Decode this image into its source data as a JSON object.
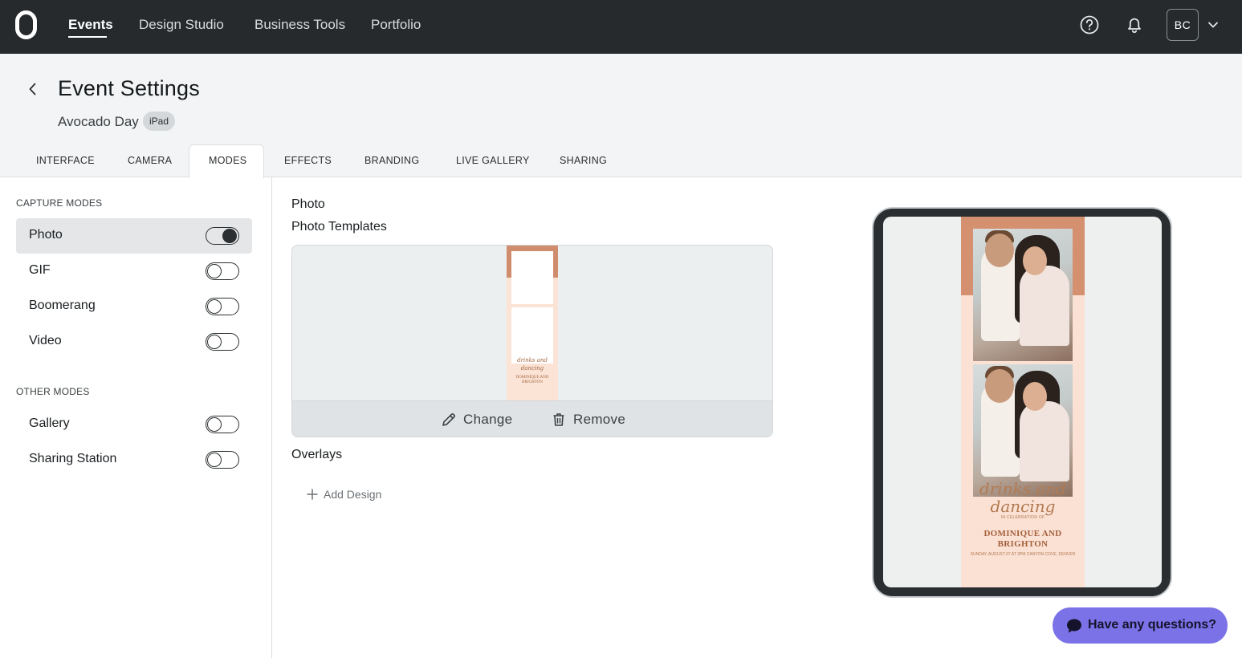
{
  "nav": {
    "links": [
      "Events",
      "Design Studio",
      "Business Tools",
      "Portfolio"
    ],
    "active": "Events",
    "user_initials": "BC"
  },
  "header": {
    "title": "Event Settings",
    "event_name": "Avocado Day",
    "device_badge": "iPad"
  },
  "tabs": {
    "items": [
      "INTERFACE",
      "CAMERA",
      "MODES",
      "EFFECTS",
      "BRANDING",
      "LIVE GALLERY",
      "SHARING"
    ],
    "active": "MODES"
  },
  "capture_modes": {
    "label": "CAPTURE MODES",
    "items": [
      {
        "label": "Photo",
        "on": true,
        "selected": true
      },
      {
        "label": "GIF",
        "on": false
      },
      {
        "label": "Boomerang",
        "on": false
      },
      {
        "label": "Video",
        "on": false
      }
    ]
  },
  "other_modes": {
    "label": "OTHER MODES",
    "items": [
      {
        "label": "Gallery",
        "on": false
      },
      {
        "label": "Sharing Station",
        "on": false
      }
    ]
  },
  "main": {
    "mode_title": "Photo",
    "templates_title": "Photo Templates",
    "change_label": "Change",
    "remove_label": "Remove",
    "overlays_title": "Overlays",
    "add_design_label": "Add Design"
  },
  "preview": {
    "script_text": "drinks and dancing",
    "sub_text": "IN CELEBRATION OF",
    "names_text": "DOMINIQUE AND BRIGHTON",
    "date_text": "SUNDAY, AUGUST 07 AT 3PM CANYON COVE, DENVER"
  },
  "chat": {
    "label": "Have any questions?"
  },
  "colors": {
    "nav_bg": "#262a2d",
    "strip_accent": "#d5906f",
    "strip_bg": "#fbe1d4",
    "chat_bg": "#7a72e6"
  }
}
